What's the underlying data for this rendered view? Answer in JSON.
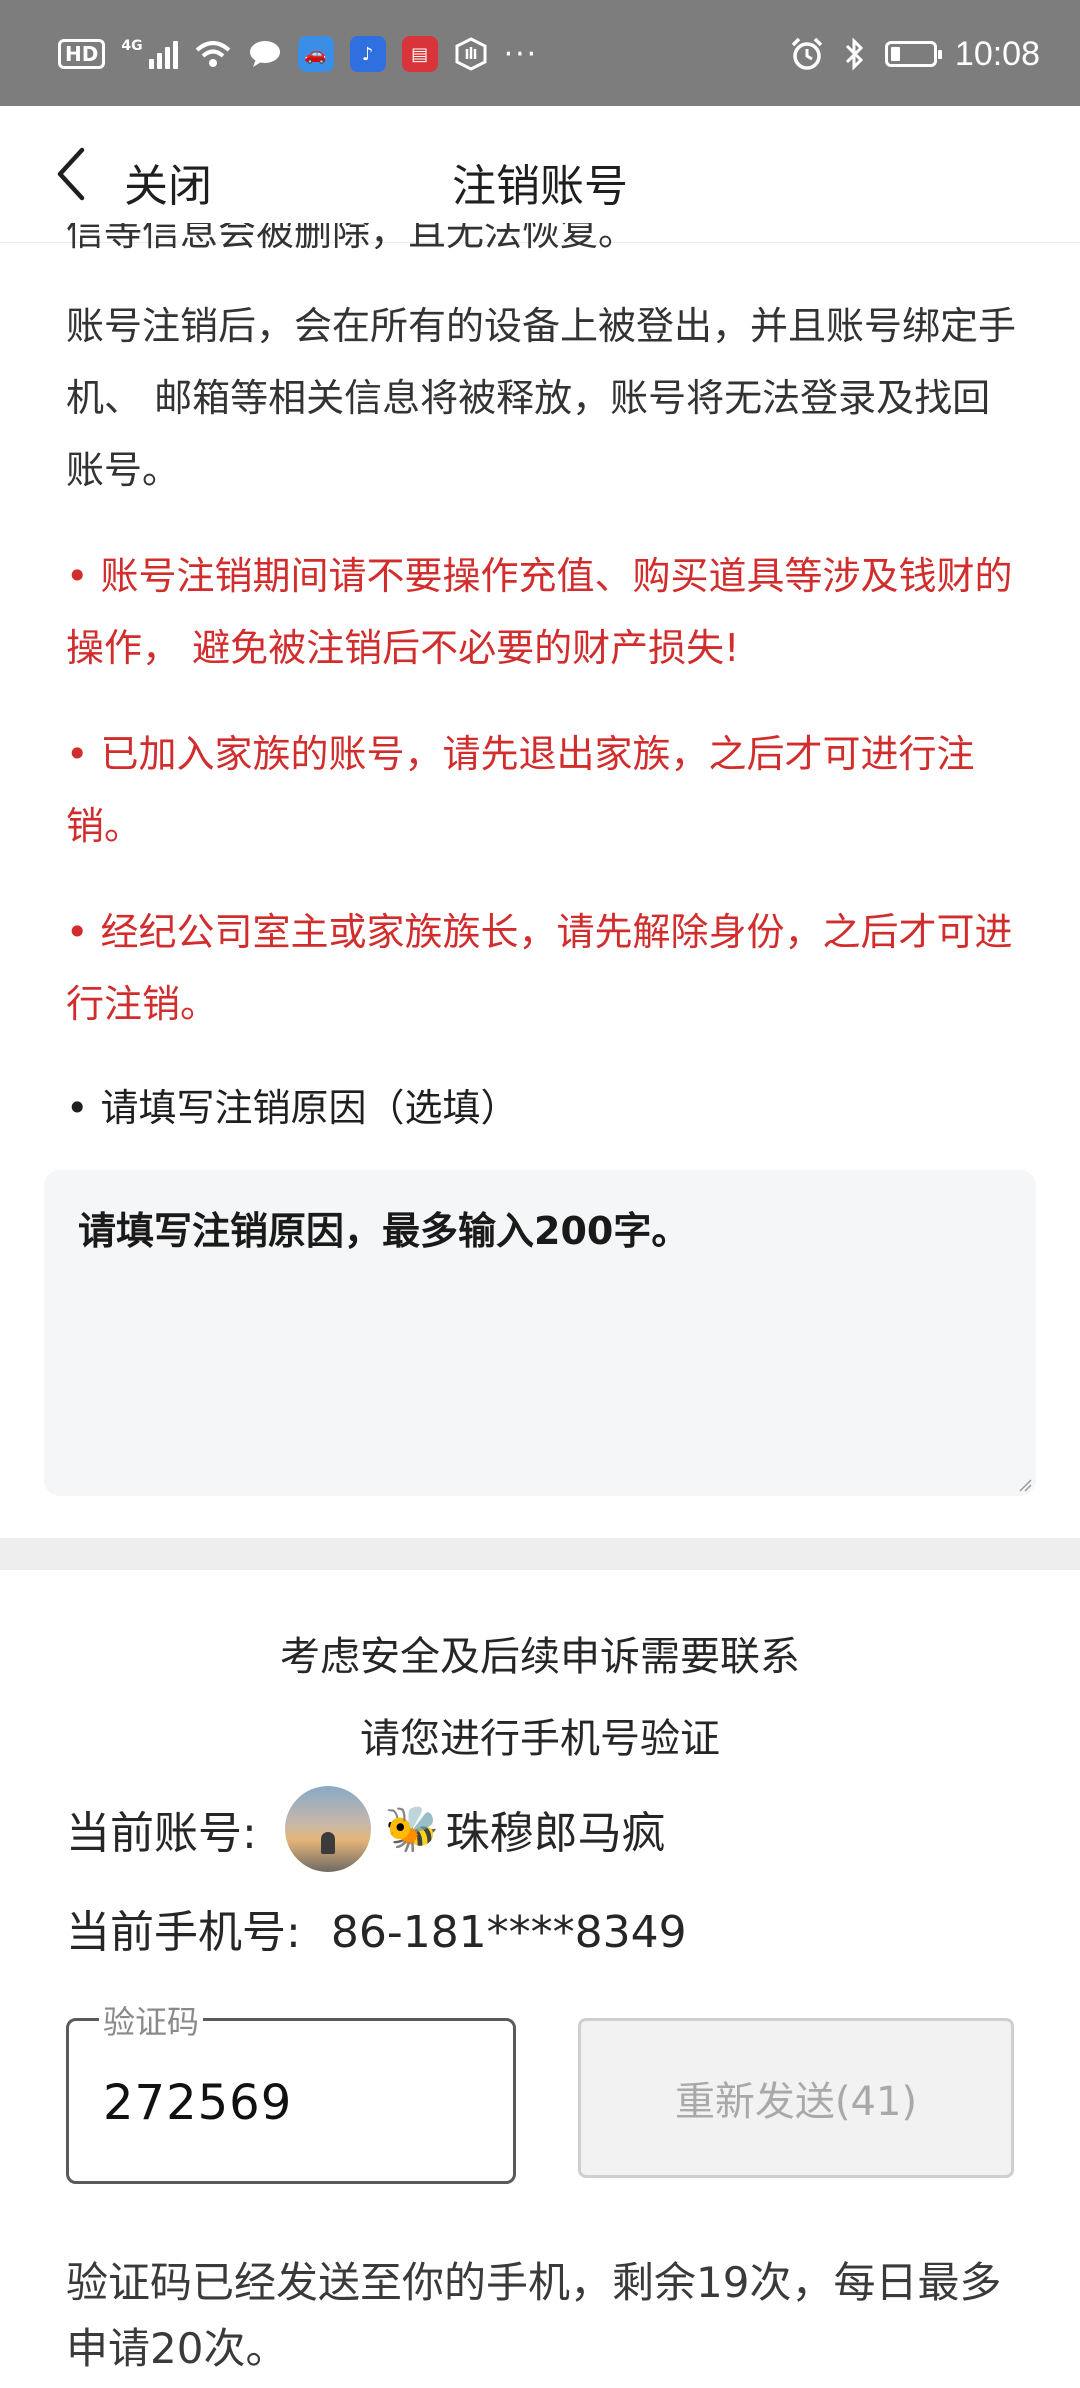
{
  "status_bar": {
    "hd": "HD",
    "network": "4G",
    "time": "10:08",
    "more": "···"
  },
  "nav": {
    "close_label": "关闭",
    "title": "注销账号"
  },
  "content": {
    "partial_top": "信等信息会被删除，且无法恢复。",
    "para1": "账号注销后，会在所有的设备上被登出，并且账号绑定手机、 邮箱等相关信息将被释放，账号将无法登录及找回账号。",
    "warnings": [
      "• 账号注销期间请不要操作充值、购买道具等涉及钱财的操作， 避免被注销后不必要的财产损失!",
      "• 已加入家族的账号，请先退出家族，之后才可进行注销。",
      "• 经纪公司室主或家族族长，请先解除身份，之后才可进行注销。"
    ],
    "reason_label": "• 请填写注销原因（选填）",
    "reason_placeholder": "请填写注销原因，最多输入200字。"
  },
  "verify": {
    "line1": "考虑安全及后续申诉需要联系",
    "line2": "请您进行手机号验证",
    "account_label": "当前账号:",
    "account_name": "珠穆郎马疯",
    "phone_label": "当前手机号:",
    "phone_value": "86-181****8349",
    "code_legend": "验证码",
    "code_value": "272569",
    "resend_label": "重新发送(41)",
    "notice": "验证码已经发送至你的手机，剩余19次，每日最多申请20次。"
  },
  "colors": {
    "status_bar": "#7d7d7d",
    "warning_red": "#d22d2d",
    "input_bg": "#f5f6f7"
  }
}
